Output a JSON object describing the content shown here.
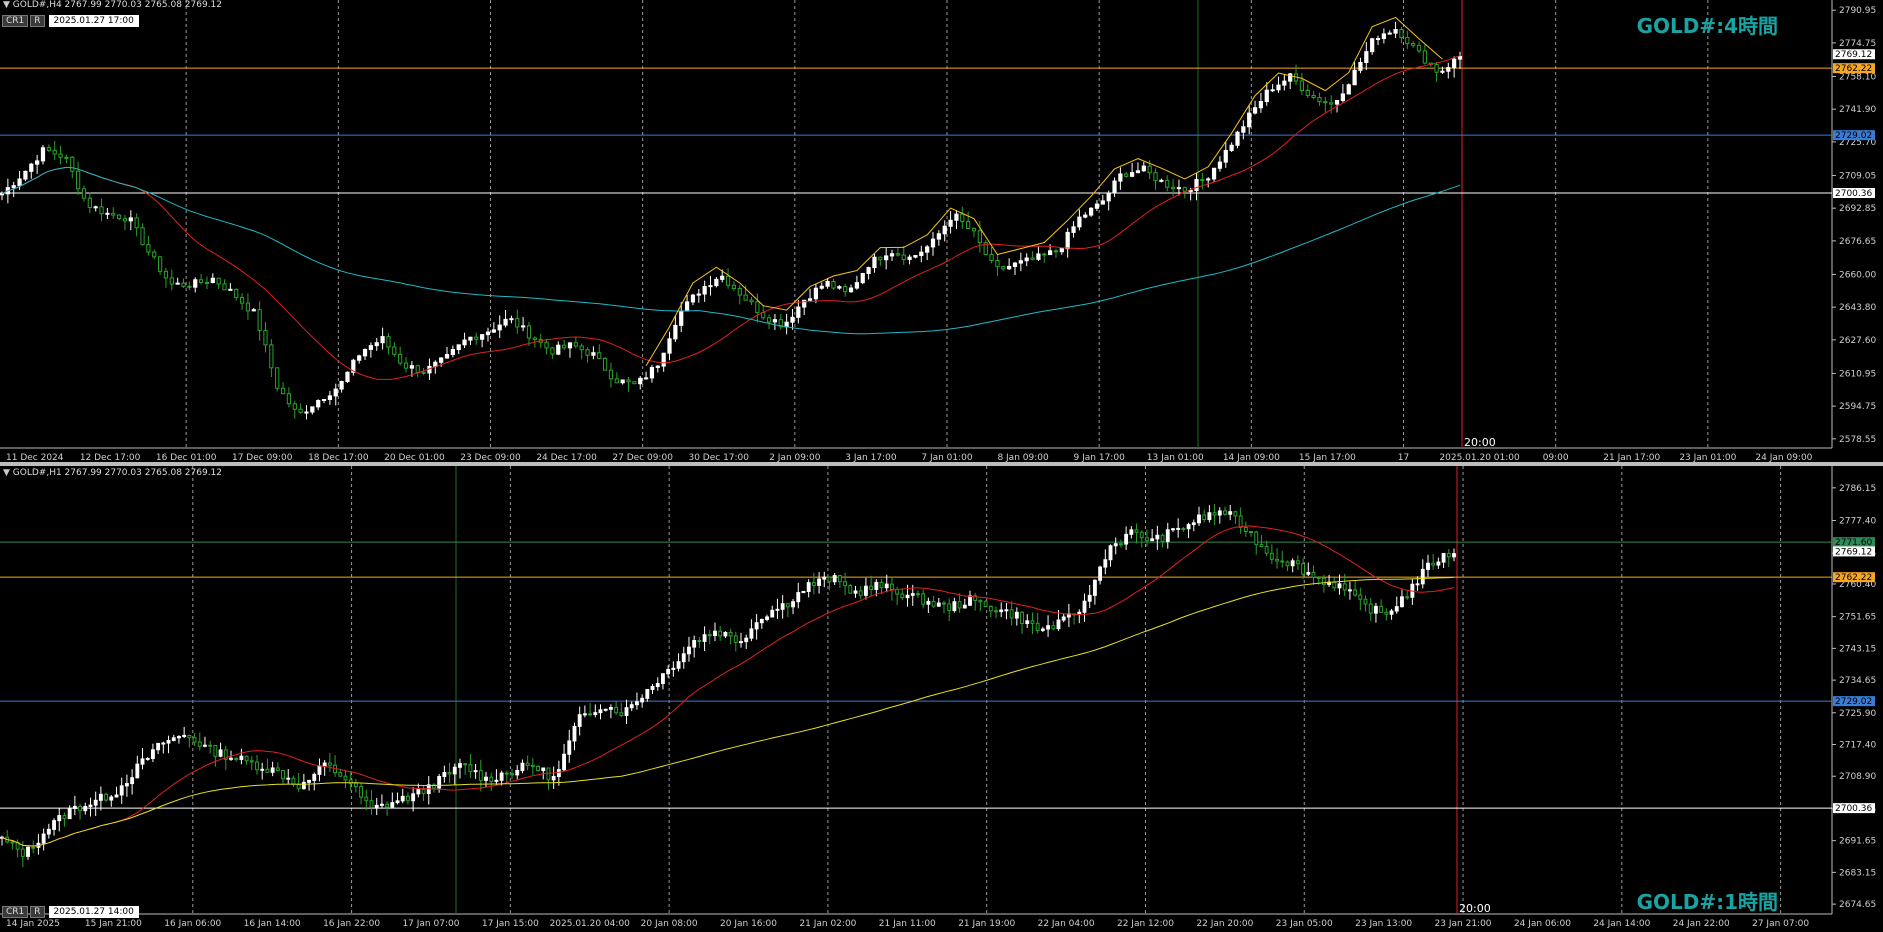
{
  "top": {
    "header": "GOLD#,H4  2767.99 2770.03 2765.08 2769.12",
    "cr": "CR1",
    "r": "R",
    "datetime": "2025.01.27 17:00",
    "watermark": "GOLD#:4時間",
    "time_marker": "20:00",
    "ymin": 2574,
    "ymax": 2796,
    "price_labels": [
      "2790.95",
      "2774.75",
      "2758.10",
      "2741.90",
      "2725.70",
      "2709.05",
      "2692.85",
      "2676.65",
      "2660.00",
      "2643.80",
      "2627.60",
      "2610.95",
      "2594.75",
      "2578.55"
    ],
    "hlines": [
      {
        "price": 2762.22,
        "label": "2762.22",
        "color": "#f5a623"
      },
      {
        "price": 2729.02,
        "label": "2729.02",
        "color": "#3a7bd5"
      },
      {
        "price": 2700.36,
        "label": "2700.36",
        "color": "#ffffff"
      }
    ],
    "current_price": "2769.12",
    "x_labels": [
      "11 Dec 2024",
      "12 Dec 17:00",
      "16 Dec 01:00",
      "17 Dec 09:00",
      "18 Dec 17:00",
      "20 Dec 01:00",
      "23 Dec 09:00",
      "24 Dec 17:00",
      "27 Dec 09:00",
      "30 Dec 17:00",
      "2 Jan 09:00",
      "3 Jan 17:00",
      "7 Jan 01:00",
      "8 Jan 09:00",
      "9 Jan 17:00",
      "13 Jan 01:00",
      "14 Jan 09:00",
      "15 Jan 17:00",
      "17",
      "2025.01.20 01:00",
      "09:00",
      "21 Jan 17:00",
      "23 Jan 01:00",
      "24 Jan 09:00"
    ]
  },
  "bottom": {
    "header": "GOLD#,H1  2767.99 2770.03 2765.08 2769.12",
    "cr": "CR1",
    "r": "R",
    "datetime": "2025.01.27 14:00",
    "watermark": "GOLD#:1時間",
    "time_marker": "20:00",
    "ymin": 2672,
    "ymax": 2792,
    "price_labels": [
      "2786.15",
      "2777.40",
      "2768.65",
      "2760.40",
      "2751.65",
      "2743.15",
      "2734.65",
      "2725.90",
      "2717.40",
      "2708.90",
      "2700.15",
      "2691.65",
      "2683.15",
      "2674.65"
    ],
    "hlines": [
      {
        "price": 2771.6,
        "label": "2771.60",
        "color": "#2e8b57"
      },
      {
        "price": 2762.22,
        "label": "2762.22",
        "color": "#f5a623"
      },
      {
        "price": 2729.02,
        "label": "2729.02",
        "color": "#3a7bd5"
      },
      {
        "price": 2700.36,
        "label": "2700.36",
        "color": "#ffffff"
      }
    ],
    "current_price": "2769.12",
    "x_labels": [
      "14 Jan 2025",
      "15 Jan 21:00",
      "16 Jan 06:00",
      "16 Jan 14:00",
      "16 Jan 22:00",
      "17 Jan 07:00",
      "17 Jan 15:00",
      "2025.01.20 04:00",
      "20 Jan 08:00",
      "20 Jan 16:00",
      "21 Jan 02:00",
      "21 Jan 11:00",
      "21 Jan 19:00",
      "22 Jan 04:00",
      "22 Jan 12:00",
      "22 Jan 20:00",
      "23 Jan 05:00",
      "23 Jan 13:00",
      "23 Jan 21:00",
      "24 Jan 06:00",
      "24 Jan 14:00",
      "24 Jan 22:00",
      "27 Jan 07:00"
    ]
  },
  "chart_data": [
    {
      "type": "candlestick",
      "symbol": "GOLD#",
      "timeframe": "H4",
      "ohlc_last": {
        "open": 2767.99,
        "high": 2770.03,
        "low": 2765.08,
        "close": 2769.12
      },
      "close_path_anchors": [
        2700,
        2710,
        2722,
        2718,
        2695,
        2690,
        2688,
        2670,
        2655,
        2655,
        2658,
        2650,
        2640,
        2605,
        2590,
        2598,
        2605,
        2622,
        2628,
        2615,
        2612,
        2618,
        2628,
        2632,
        2638,
        2630,
        2622,
        2625,
        2620,
        2608,
        2605,
        2615,
        2640,
        2652,
        2660,
        2650,
        2640,
        2635,
        2648,
        2656,
        2650,
        2665,
        2672,
        2668,
        2675,
        2690,
        2680,
        2662,
        2665,
        2668,
        2672,
        2688,
        2695,
        2710,
        2712,
        2705,
        2702,
        2708,
        2722,
        2738,
        2752,
        2758,
        2748,
        2744,
        2760,
        2778,
        2782,
        2770,
        2760,
        2768
      ],
      "horizontal_levels": [
        2762.22,
        2729.02,
        2700.36
      ],
      "ylim": [
        2574,
        2796
      ]
    },
    {
      "type": "candlestick",
      "symbol": "GOLD#",
      "timeframe": "H1",
      "ohlc_last": {
        "open": 2767.99,
        "high": 2770.03,
        "low": 2765.08,
        "close": 2769.12
      },
      "close_path_anchors": [
        2692,
        2688,
        2695,
        2700,
        2702,
        2705,
        2712,
        2718,
        2720,
        2716,
        2714,
        2712,
        2710,
        2706,
        2712,
        2708,
        2700,
        2702,
        2704,
        2708,
        2712,
        2708,
        2710,
        2712,
        2708,
        2724,
        2728,
        2726,
        2732,
        2738,
        2745,
        2748,
        2745,
        2752,
        2755,
        2760,
        2762,
        2758,
        2760,
        2758,
        2756,
        2754,
        2756,
        2754,
        2752,
        2748,
        2750,
        2755,
        2770,
        2774,
        2772,
        2775,
        2778,
        2780,
        2775,
        2768,
        2766,
        2762,
        2760,
        2755,
        2752,
        2758,
        2766,
        2769
      ],
      "horizontal_levels": [
        2771.6,
        2762.22,
        2729.02,
        2700.36
      ],
      "ylim": [
        2672,
        2792
      ]
    }
  ]
}
